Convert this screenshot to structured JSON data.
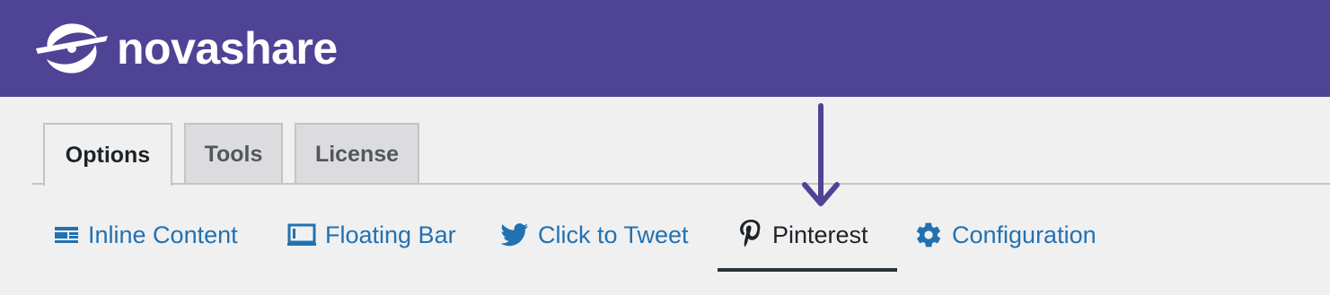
{
  "brand": {
    "name": "novashare",
    "header_color": "#4f4396",
    "logo_icon": "novashare-logo-icon"
  },
  "tabs": [
    {
      "label": "Options",
      "active": true
    },
    {
      "label": "Tools",
      "active": false
    },
    {
      "label": "License",
      "active": false
    }
  ],
  "subnav": [
    {
      "label": "Inline Content",
      "icon": "inline-content-icon",
      "active": false
    },
    {
      "label": "Floating Bar",
      "icon": "floating-bar-icon",
      "active": false
    },
    {
      "label": "Click to Tweet",
      "icon": "twitter-bird-icon",
      "active": false
    },
    {
      "label": "Pinterest",
      "icon": "pinterest-icon",
      "active": true
    },
    {
      "label": "Configuration",
      "icon": "gear-icon",
      "active": false
    }
  ],
  "annotation": {
    "type": "arrow-down",
    "color": "#4f4396",
    "points_to": "Pinterest"
  },
  "colors": {
    "link": "#2271b1",
    "active_text": "#1d2327",
    "background": "#f0f0f1"
  }
}
